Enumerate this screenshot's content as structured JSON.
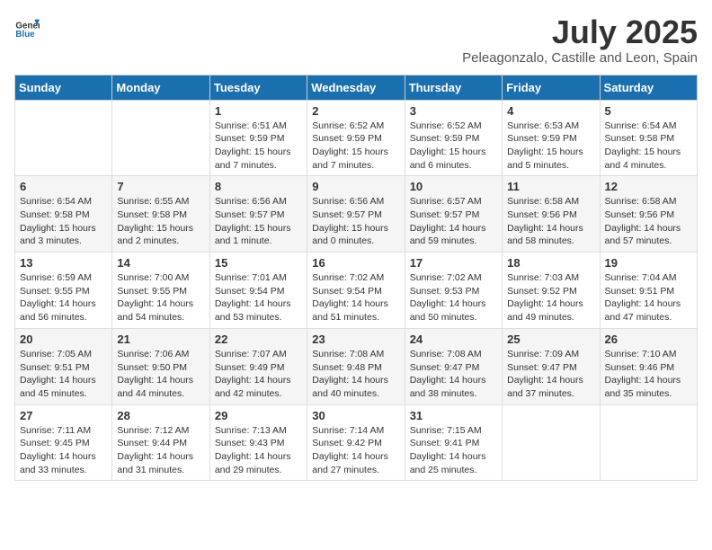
{
  "header": {
    "logo_general": "General",
    "logo_blue": "Blue",
    "month": "July 2025",
    "location": "Peleagonzalo, Castille and Leon, Spain"
  },
  "weekdays": [
    "Sunday",
    "Monday",
    "Tuesday",
    "Wednesday",
    "Thursday",
    "Friday",
    "Saturday"
  ],
  "weeks": [
    [
      {
        "day": "",
        "info": ""
      },
      {
        "day": "",
        "info": ""
      },
      {
        "day": "1",
        "info": "Sunrise: 6:51 AM\nSunset: 9:59 PM\nDaylight: 15 hours\nand 7 minutes."
      },
      {
        "day": "2",
        "info": "Sunrise: 6:52 AM\nSunset: 9:59 PM\nDaylight: 15 hours\nand 7 minutes."
      },
      {
        "day": "3",
        "info": "Sunrise: 6:52 AM\nSunset: 9:59 PM\nDaylight: 15 hours\nand 6 minutes."
      },
      {
        "day": "4",
        "info": "Sunrise: 6:53 AM\nSunset: 9:59 PM\nDaylight: 15 hours\nand 5 minutes."
      },
      {
        "day": "5",
        "info": "Sunrise: 6:54 AM\nSunset: 9:58 PM\nDaylight: 15 hours\nand 4 minutes."
      }
    ],
    [
      {
        "day": "6",
        "info": "Sunrise: 6:54 AM\nSunset: 9:58 PM\nDaylight: 15 hours\nand 3 minutes."
      },
      {
        "day": "7",
        "info": "Sunrise: 6:55 AM\nSunset: 9:58 PM\nDaylight: 15 hours\nand 2 minutes."
      },
      {
        "day": "8",
        "info": "Sunrise: 6:56 AM\nSunset: 9:57 PM\nDaylight: 15 hours\nand 1 minute."
      },
      {
        "day": "9",
        "info": "Sunrise: 6:56 AM\nSunset: 9:57 PM\nDaylight: 15 hours\nand 0 minutes."
      },
      {
        "day": "10",
        "info": "Sunrise: 6:57 AM\nSunset: 9:57 PM\nDaylight: 14 hours\nand 59 minutes."
      },
      {
        "day": "11",
        "info": "Sunrise: 6:58 AM\nSunset: 9:56 PM\nDaylight: 14 hours\nand 58 minutes."
      },
      {
        "day": "12",
        "info": "Sunrise: 6:58 AM\nSunset: 9:56 PM\nDaylight: 14 hours\nand 57 minutes."
      }
    ],
    [
      {
        "day": "13",
        "info": "Sunrise: 6:59 AM\nSunset: 9:55 PM\nDaylight: 14 hours\nand 56 minutes."
      },
      {
        "day": "14",
        "info": "Sunrise: 7:00 AM\nSunset: 9:55 PM\nDaylight: 14 hours\nand 54 minutes."
      },
      {
        "day": "15",
        "info": "Sunrise: 7:01 AM\nSunset: 9:54 PM\nDaylight: 14 hours\nand 53 minutes."
      },
      {
        "day": "16",
        "info": "Sunrise: 7:02 AM\nSunset: 9:54 PM\nDaylight: 14 hours\nand 51 minutes."
      },
      {
        "day": "17",
        "info": "Sunrise: 7:02 AM\nSunset: 9:53 PM\nDaylight: 14 hours\nand 50 minutes."
      },
      {
        "day": "18",
        "info": "Sunrise: 7:03 AM\nSunset: 9:52 PM\nDaylight: 14 hours\nand 49 minutes."
      },
      {
        "day": "19",
        "info": "Sunrise: 7:04 AM\nSunset: 9:51 PM\nDaylight: 14 hours\nand 47 minutes."
      }
    ],
    [
      {
        "day": "20",
        "info": "Sunrise: 7:05 AM\nSunset: 9:51 PM\nDaylight: 14 hours\nand 45 minutes."
      },
      {
        "day": "21",
        "info": "Sunrise: 7:06 AM\nSunset: 9:50 PM\nDaylight: 14 hours\nand 44 minutes."
      },
      {
        "day": "22",
        "info": "Sunrise: 7:07 AM\nSunset: 9:49 PM\nDaylight: 14 hours\nand 42 minutes."
      },
      {
        "day": "23",
        "info": "Sunrise: 7:08 AM\nSunset: 9:48 PM\nDaylight: 14 hours\nand 40 minutes."
      },
      {
        "day": "24",
        "info": "Sunrise: 7:08 AM\nSunset: 9:47 PM\nDaylight: 14 hours\nand 38 minutes."
      },
      {
        "day": "25",
        "info": "Sunrise: 7:09 AM\nSunset: 9:47 PM\nDaylight: 14 hours\nand 37 minutes."
      },
      {
        "day": "26",
        "info": "Sunrise: 7:10 AM\nSunset: 9:46 PM\nDaylight: 14 hours\nand 35 minutes."
      }
    ],
    [
      {
        "day": "27",
        "info": "Sunrise: 7:11 AM\nSunset: 9:45 PM\nDaylight: 14 hours\nand 33 minutes."
      },
      {
        "day": "28",
        "info": "Sunrise: 7:12 AM\nSunset: 9:44 PM\nDaylight: 14 hours\nand 31 minutes."
      },
      {
        "day": "29",
        "info": "Sunrise: 7:13 AM\nSunset: 9:43 PM\nDaylight: 14 hours\nand 29 minutes."
      },
      {
        "day": "30",
        "info": "Sunrise: 7:14 AM\nSunset: 9:42 PM\nDaylight: 14 hours\nand 27 minutes."
      },
      {
        "day": "31",
        "info": "Sunrise: 7:15 AM\nSunset: 9:41 PM\nDaylight: 14 hours\nand 25 minutes."
      },
      {
        "day": "",
        "info": ""
      },
      {
        "day": "",
        "info": ""
      }
    ]
  ]
}
